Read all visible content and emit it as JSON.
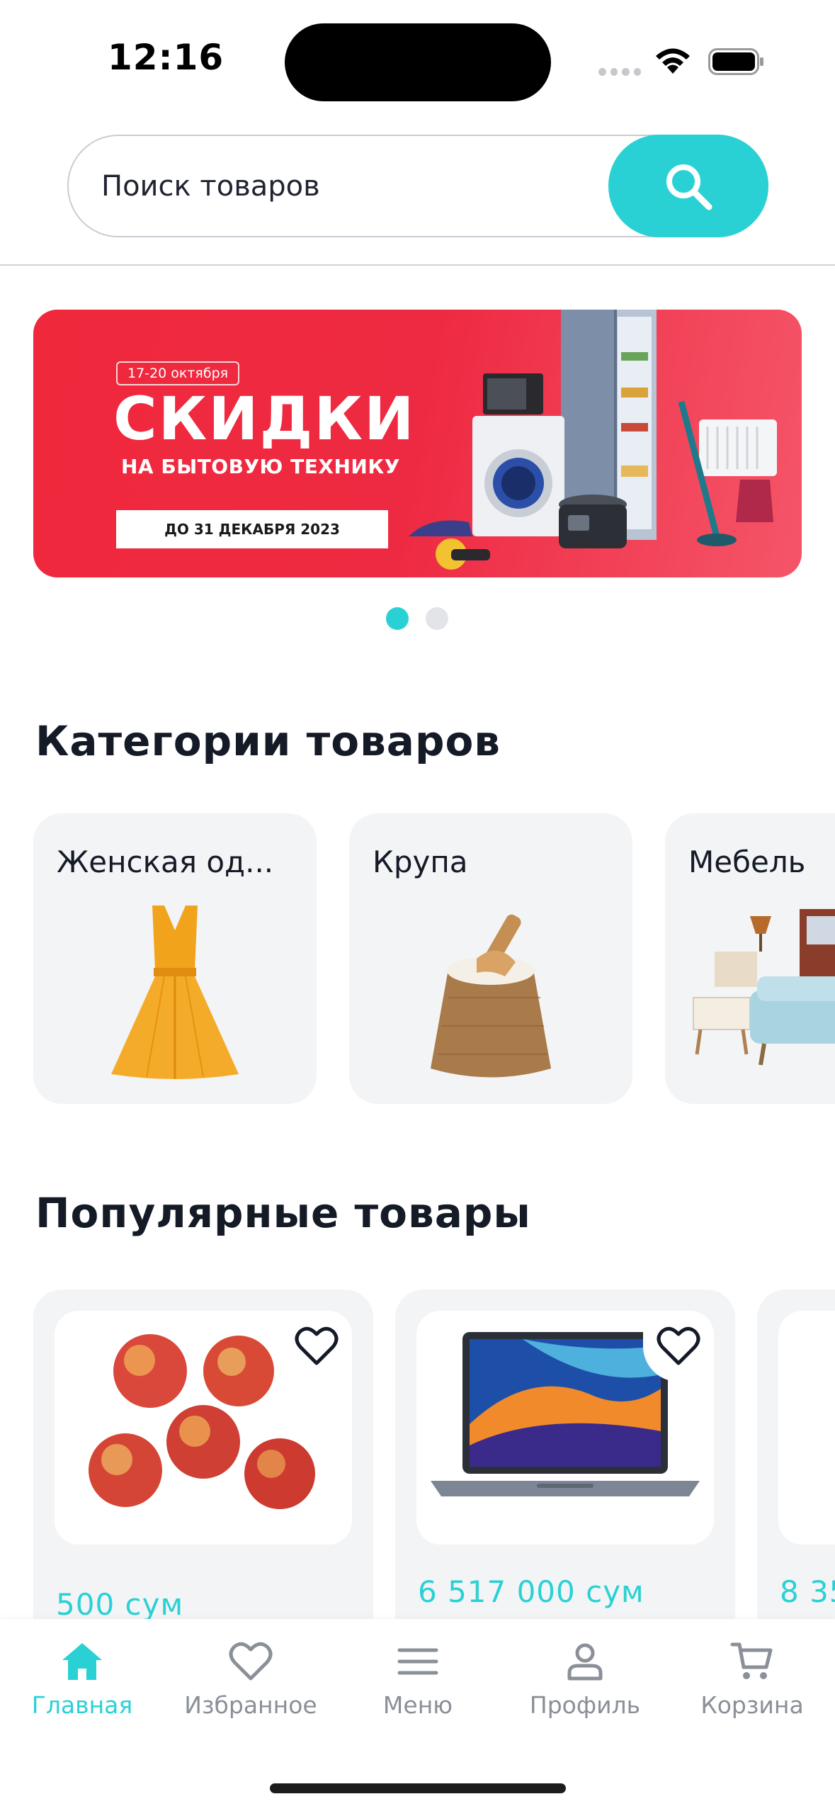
{
  "status_bar": {
    "time": "12:16"
  },
  "search": {
    "placeholder": "Поиск товаров"
  },
  "banner": {
    "date_range": "17-20 октября",
    "title": "СКИДКИ",
    "subtitle": "НА БЫТОВУЮ ТЕХНИКУ",
    "deadline": "ДО 31 ДЕКАБРЯ 2023"
  },
  "carousel": {
    "pages": 2,
    "active_page": 1
  },
  "categories": {
    "title": "Категории товаров",
    "items": [
      {
        "label": "Женская од...",
        "icon": "dress-image"
      },
      {
        "label": "Крупа",
        "icon": "grain-sack-image"
      },
      {
        "label": "Мебель",
        "icon": "furniture-image"
      }
    ]
  },
  "popular": {
    "title": "Популярные товары",
    "items": [
      {
        "price": "500 сум",
        "icon": "apples-image"
      },
      {
        "price": "6 517 000  сум",
        "icon": "laptop-image"
      },
      {
        "price": "8 35",
        "icon": "product-image"
      }
    ]
  },
  "tabs": [
    {
      "label": "Главная",
      "icon": "home-icon",
      "active": true
    },
    {
      "label": "Избранное",
      "icon": "heart-icon",
      "active": false
    },
    {
      "label": "Меню",
      "icon": "menu-icon",
      "active": false
    },
    {
      "label": "Профиль",
      "icon": "profile-icon",
      "active": false
    },
    {
      "label": "Корзина",
      "icon": "cart-icon",
      "active": false
    }
  ],
  "colors": {
    "accent": "#2ad1d4",
    "banner_red": "#ee2a42",
    "card_bg": "#f3f4f6",
    "text_dark": "#141a26",
    "tab_inactive": "#8a8f98"
  }
}
